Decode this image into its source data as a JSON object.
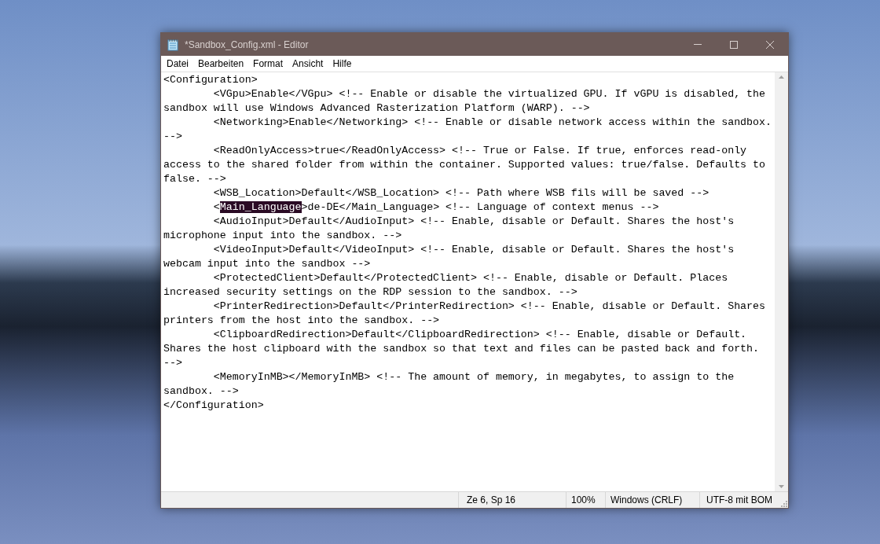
{
  "window": {
    "title": "*Sandbox_Config.xml - Editor"
  },
  "menu": [
    "Datei",
    "Bearbeiten",
    "Format",
    "Ansicht",
    "Hilfe"
  ],
  "lines": [
    {
      "text": "<Configuration>"
    },
    {
      "text": "        <VGpu>Enable</VGpu> <!-- Enable or disable the virtualized GPU. If vGPU is disabled, the"
    },
    {
      "text": "sandbox will use Windows Advanced Rasterization Platform (WARP). -->"
    },
    {
      "text": "        <Networking>Enable</Networking> <!-- Enable or disable network access within the sandbox."
    },
    {
      "text": "-->"
    },
    {
      "text": "        <ReadOnlyAccess>true</ReadOnlyAccess> <!-- True or False. If true, enforces read-only"
    },
    {
      "text": "access to the shared folder from within the container. Supported values: true/false. Defaults to"
    },
    {
      "text": "false. -->"
    },
    {
      "text": "        <WSB_Location>Default</WSB_Location> <!-- Path where WSB fils will be saved -->"
    },
    {
      "text": "        <",
      "selected_text": "Main_Language",
      "text_after": ">de-DE</Main_Language> <!-- Language of context menus -->"
    },
    {
      "text": "        <AudioInput>Default</AudioInput> <!-- Enable, disable or Default. Shares the host's"
    },
    {
      "text": "microphone input into the sandbox. -->"
    },
    {
      "text": "        <VideoInput>Default</VideoInput> <!-- Enable, disable or Default. Shares the host's"
    },
    {
      "text": "webcam input into the sandbox -->"
    },
    {
      "text": "        <ProtectedClient>Default</ProtectedClient> <!-- Enable, disable or Default. Places"
    },
    {
      "text": "increased security settings on the RDP session to the sandbox. -->"
    },
    {
      "text": "        <PrinterRedirection>Default</PrinterRedirection> <!-- Enable, disable or Default. Shares"
    },
    {
      "text": "printers from the host into the sandbox. -->"
    },
    {
      "text": "        <ClipboardRedirection>Default</ClipboardRedirection> <!-- Enable, disable or Default."
    },
    {
      "text": "Shares the host clipboard with the sandbox so that text and files can be pasted back and forth."
    },
    {
      "text": "-->"
    },
    {
      "text": "        <MemoryInMB></MemoryInMB> <!-- The amount of memory, in megabytes, to assign to the"
    },
    {
      "text": "sandbox. -->"
    },
    {
      "text": "</Configuration>"
    }
  ],
  "status_bar": {
    "position": "Ze 6, Sp 16",
    "zoom": "100%",
    "line_endings": "Windows (CRLF)",
    "encoding": "UTF-8 mit BOM"
  }
}
